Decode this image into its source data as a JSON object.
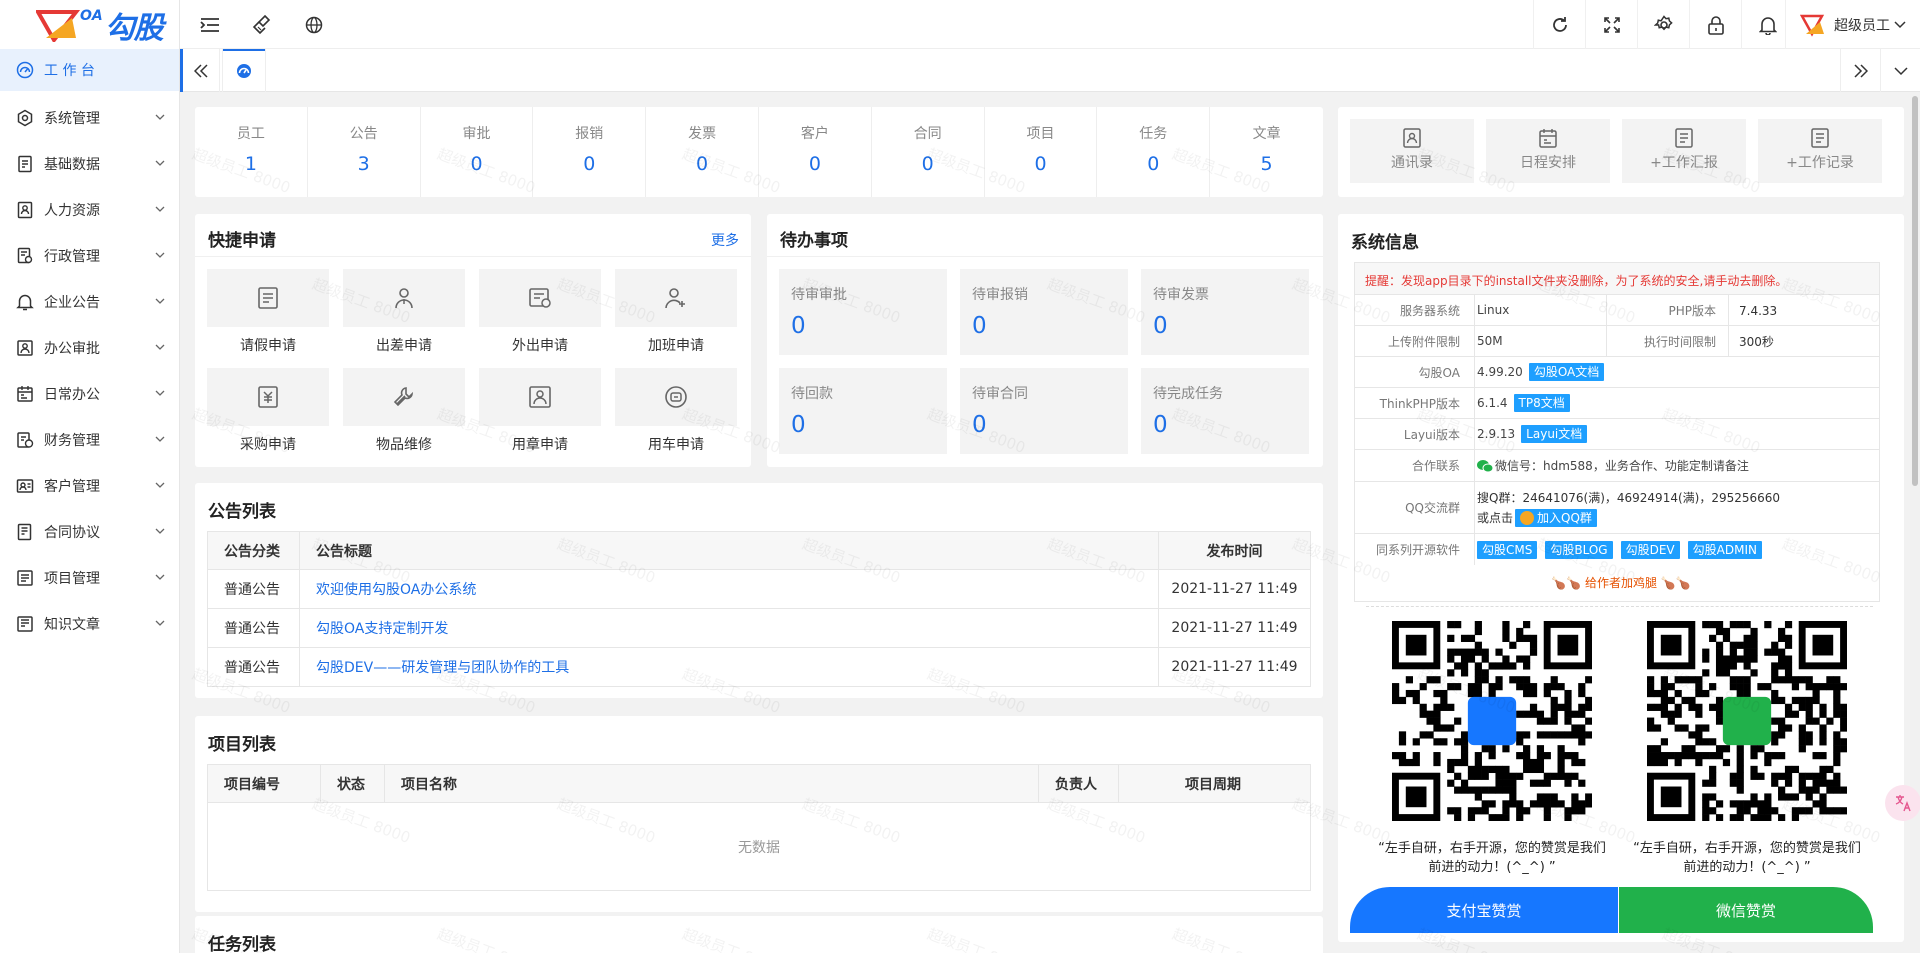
{
  "logo": {
    "oa": "OA",
    "text": "勾股"
  },
  "sidebar": {
    "items": [
      {
        "label": "工 作 台",
        "icon": "dashboard-icon"
      },
      {
        "label": "系统管理",
        "icon": "settings-icon"
      },
      {
        "label": "基础数据",
        "icon": "database-icon"
      },
      {
        "label": "人力资源",
        "icon": "person-card-icon"
      },
      {
        "label": "行政管理",
        "icon": "admin-icon"
      },
      {
        "label": "企业公告",
        "icon": "bell-icon"
      },
      {
        "label": "办公审批",
        "icon": "approval-icon"
      },
      {
        "label": "日常办公",
        "icon": "calendar-icon"
      },
      {
        "label": "财务管理",
        "icon": "finance-icon"
      },
      {
        "label": "客户管理",
        "icon": "customer-icon"
      },
      {
        "label": "合同协议",
        "icon": "contract-icon"
      },
      {
        "label": "项目管理",
        "icon": "project-icon"
      },
      {
        "label": "知识文章",
        "icon": "article-icon"
      }
    ]
  },
  "header": {
    "user_name": "超级员工"
  },
  "stats": [
    {
      "label": "员工",
      "value": "1"
    },
    {
      "label": "公告",
      "value": "3"
    },
    {
      "label": "审批",
      "value": "0"
    },
    {
      "label": "报销",
      "value": "0"
    },
    {
      "label": "发票",
      "value": "0"
    },
    {
      "label": "客户",
      "value": "0"
    },
    {
      "label": "合同",
      "value": "0"
    },
    {
      "label": "项目",
      "value": "0"
    },
    {
      "label": "任务",
      "value": "0"
    },
    {
      "label": "文章",
      "value": "5"
    }
  ],
  "quick_links": [
    {
      "label": "通讯录"
    },
    {
      "label": "日程安排"
    },
    {
      "label": "+工作汇报"
    },
    {
      "label": "+工作记录"
    }
  ],
  "shortcuts": {
    "title": "快捷申请",
    "more": "更多",
    "items": [
      {
        "label": "请假申请"
      },
      {
        "label": "出差申请"
      },
      {
        "label": "外出申请"
      },
      {
        "label": "加班申请"
      },
      {
        "label": "采购申请"
      },
      {
        "label": "物品维修"
      },
      {
        "label": "用章申请"
      },
      {
        "label": "用车申请"
      }
    ]
  },
  "todo": {
    "title": "待办事项",
    "items": [
      {
        "label": "待审审批",
        "value": "0"
      },
      {
        "label": "待审报销",
        "value": "0"
      },
      {
        "label": "待审发票",
        "value": "0"
      },
      {
        "label": "待回款",
        "value": "0"
      },
      {
        "label": "待审合同",
        "value": "0"
      },
      {
        "label": "待完成任务",
        "value": "0"
      }
    ]
  },
  "notices": {
    "title": "公告列表",
    "headers": [
      "公告分类",
      "公告标题",
      "发布时间"
    ],
    "rows": [
      {
        "category": "普通公告",
        "title": "欢迎使用勾股OA办公系统",
        "time": "2021-11-27 11:49"
      },
      {
        "category": "普通公告",
        "title": "勾股OA支持定制开发",
        "time": "2021-11-27 11:49"
      },
      {
        "category": "普通公告",
        "title": "勾股DEV——研发管理与团队协作的工具",
        "time": "2021-11-27 11:49"
      }
    ]
  },
  "projects": {
    "title": "项目列表",
    "headers": [
      "项目编号",
      "状态",
      "项目名称",
      "负责人",
      "项目周期"
    ],
    "empty": "无数据"
  },
  "tasks": {
    "title": "任务列表"
  },
  "sysinfo": {
    "title": "系统信息",
    "warning": "提醒：发现app目录下的install文件夹没删除，为了系统的安全,请手动去删除。",
    "server_k": "服务器系统",
    "server_v": "Linux",
    "php_k": "PHP版本",
    "php_v": "7.4.33",
    "upload_k": "上传附件限制",
    "upload_v": "50M",
    "exec_k": "执行时间限制",
    "exec_v": "300秒",
    "oa_k": "勾股OA",
    "oa_v": "4.99.20",
    "oa_badge": "勾股OA文档",
    "tp_k": "ThinkPHP版本",
    "tp_v": "6.1.4",
    "tp_badge": "TP8文档",
    "layui_k": "Layui版本",
    "layui_v": "2.9.13",
    "layui_badge": "Layui文档",
    "coop_k": "合作联系",
    "coop_v": "微信号：hdm588，业务合作、功能定制请备注",
    "qq_k": "QQ交流群",
    "qq_v1": "搜Q群：24641076(满)，46924914(满)，295256660",
    "qq_v2": "或点击",
    "qq_badge": "加入QQ群",
    "os_k": "同系列开源软件",
    "os_badges": [
      "勾股CMS",
      "勾股BLOG",
      "勾股DEV",
      "勾股ADMIN"
    ],
    "donate_title": "给作者加鸡腿",
    "donate_text": "“左手自研，右手开源，您的赞赏是我们前进的动力！(^_^) ”",
    "alipay_btn": "支付宝赞赏",
    "wechat_btn": "微信赞赏"
  },
  "watermark": "超级员工 8000",
  "colors": {
    "accent": "#1e6fe6",
    "alipay": "#1677ff",
    "wechat": "#21b14b",
    "warning": "#e53935"
  }
}
